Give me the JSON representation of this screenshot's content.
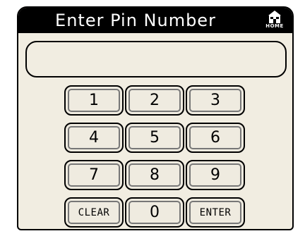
{
  "title": "Enter Pin Number",
  "home_label": "HOME",
  "pin_value": "",
  "keys": [
    "1",
    "2",
    "3",
    "4",
    "5",
    "6",
    "7",
    "8",
    "9",
    "CLEAR",
    "0",
    "ENTER"
  ]
}
